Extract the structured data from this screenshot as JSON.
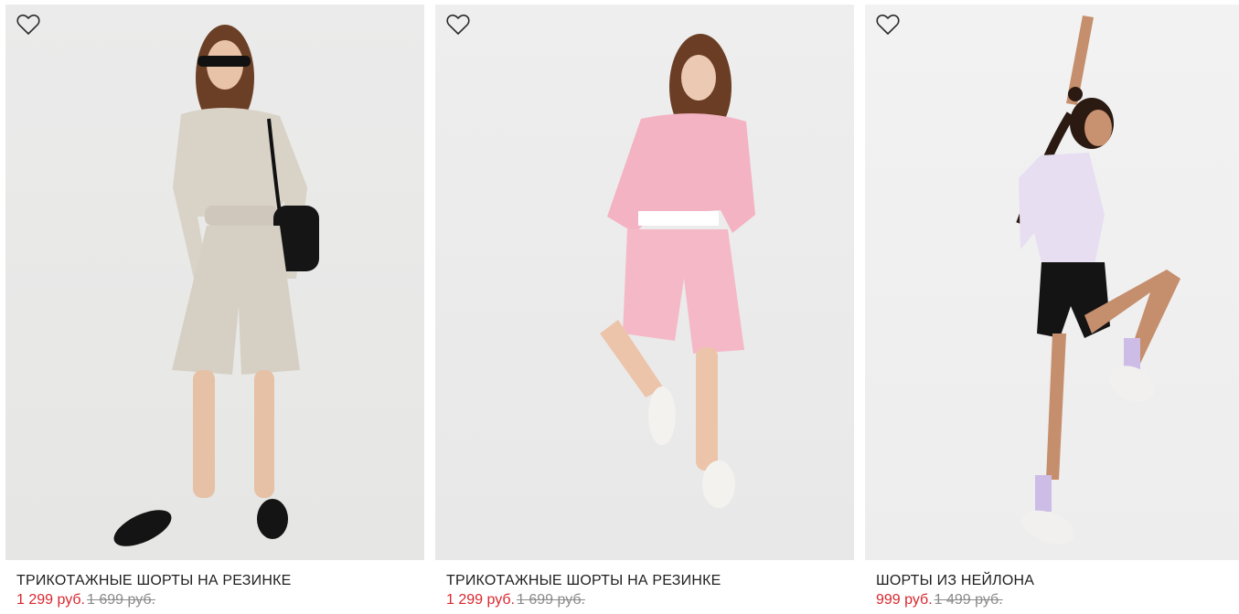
{
  "products": [
    {
      "title": "ТРИКОТАЖНЫЕ ШОРТЫ НА РЕЗИНКЕ",
      "price_current": "1 299 руб.",
      "price_old": "1 699 руб.",
      "image_alt": "model in beige sweatshirt and shorts with black bag",
      "outfit_color": "#d9d2c7"
    },
    {
      "title": "ТРИКОТАЖНЫЕ ШОРТЫ НА РЕЗИНКЕ",
      "price_current": "1 299 руб.",
      "price_old": "1 699 руб.",
      "image_alt": "model in pink sweatshirt and shorts",
      "outfit_color": "#f4b3c3"
    },
    {
      "title": "ШОРТЫ ИЗ НЕЙЛОНА",
      "price_current": "999 руб.",
      "price_old": "1 499 руб.",
      "image_alt": "model in tie-dye t-shirt and black nylon shorts",
      "outfit_color": "#1f1f1f"
    }
  ],
  "icons": {
    "favorite": "heart-outline-icon"
  },
  "colors": {
    "sale_price": "#d9272e",
    "old_price": "#8a8a8a",
    "title": "#1f1f1f"
  }
}
